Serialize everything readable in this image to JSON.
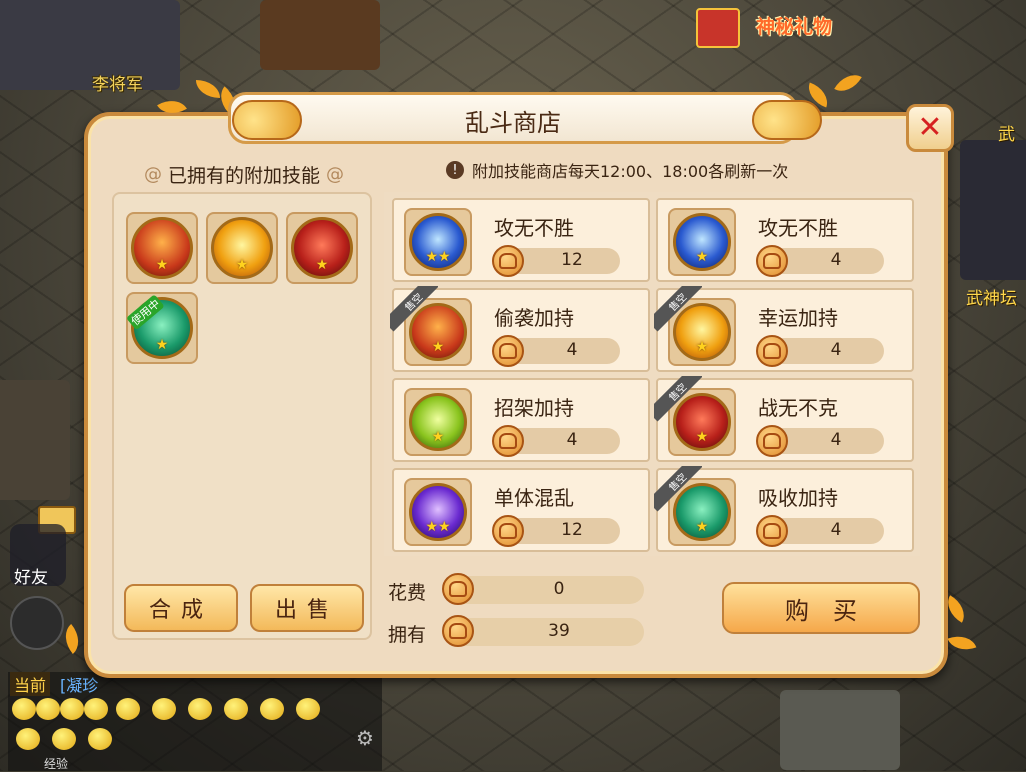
{
  "world": {
    "npc_name": "李将军",
    "gift_label": "神秘礼物",
    "side_text_1": "武",
    "side_text_2": "武神坛",
    "friend_label": "好友",
    "chat_tab_current": "当前",
    "chat_tab_other": "[凝珍",
    "xp_label": "经验"
  },
  "dialog": {
    "title": "乱斗商店",
    "owned_title": "已拥有的附加技能",
    "notice": "附加技能商店每天12:00、18:00各刷新一次",
    "in_use_label": "使用中",
    "soldout_label": "售空",
    "compose_label": "合成",
    "sell_label": "出售",
    "cost_label": "花费",
    "owned_label": "拥有",
    "cost_value": "0",
    "owned_value": "39",
    "buy_label": "购买"
  },
  "owned_skills": [
    {
      "icon": "sneak-attack-icon",
      "color": "#c8381a",
      "stars": "★"
    },
    {
      "icon": "lucky-sun-icon",
      "color": "#f0a010",
      "stars": "★"
    },
    {
      "icon": "war-face-icon",
      "color": "#b8201a",
      "stars": "★"
    },
    {
      "icon": "absorb-icon",
      "color": "#1a9a6a",
      "stars": "★"
    }
  ],
  "shop_items": [
    {
      "name": "攻无不胜",
      "price": "12",
      "stars": "★★",
      "icon": "lightning-orb-icon",
      "color": "#2a5ad0",
      "soldout": false
    },
    {
      "name": "攻无不胜",
      "price": "4",
      "stars": "★",
      "icon": "lightning-orb-icon",
      "color": "#2a5ad0",
      "soldout": false
    },
    {
      "name": "偷袭加持",
      "price": "4",
      "stars": "★",
      "icon": "sneak-attack-icon",
      "color": "#c8381a",
      "soldout": true
    },
    {
      "name": "幸运加持",
      "price": "4",
      "stars": "★",
      "icon": "lucky-sun-icon",
      "color": "#f0a010",
      "soldout": true
    },
    {
      "name": "招架加持",
      "price": "4",
      "stars": "★",
      "icon": "parry-icon",
      "color": "#8ac41e",
      "soldout": false
    },
    {
      "name": "战无不克",
      "price": "4",
      "stars": "★",
      "icon": "war-face-icon",
      "color": "#b8201a",
      "soldout": true
    },
    {
      "name": "单体混乱",
      "price": "12",
      "stars": "★★",
      "icon": "chaos-orb-icon",
      "color": "#6a2ad0",
      "soldout": false
    },
    {
      "name": "吸收加持",
      "price": "4",
      "stars": "★",
      "icon": "absorb-icon",
      "color": "#1a9a6a",
      "soldout": true
    }
  ]
}
